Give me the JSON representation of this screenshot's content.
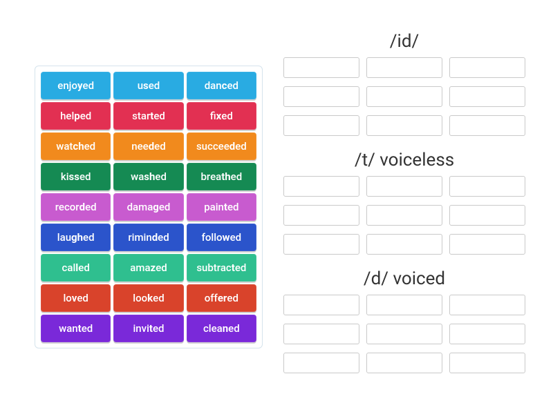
{
  "colors": {
    "blue": "#29abe2",
    "red": "#e23052",
    "orange": "#f18a1d",
    "darkgreen": "#158a53",
    "pink": "#c85bcf",
    "dblue": "#2b54cb",
    "teal": "#2fbf8f",
    "red2": "#d9432b",
    "purple": "#7a29d9"
  },
  "word_bank": {
    "rows": [
      [
        {
          "pre": "enjo",
          "bold": "y",
          "post": "ed",
          "color": "blue"
        },
        {
          "pre": "u",
          "bold": "s",
          "post": "ed",
          "color": "blue"
        },
        {
          "pre": "dan",
          "bold": "c",
          "post": "ed",
          "color": "blue"
        }
      ],
      [
        {
          "pre": "hel",
          "bold": "p",
          "post": "ed",
          "color": "red"
        },
        {
          "pre": "star",
          "bold": "t",
          "post": "ed",
          "color": "red"
        },
        {
          "pre": "fi",
          "bold": "x",
          "post": "ed",
          "color": "red"
        }
      ],
      [
        {
          "pre": "wat",
          "bold": "ch",
          "post": "ed",
          "color": "orange"
        },
        {
          "pre": "nee",
          "bold": "d",
          "post": "ed",
          "color": "orange"
        },
        {
          "pre": "succee",
          "bold": "d",
          "post": "ed",
          "color": "orange"
        }
      ],
      [
        {
          "pre": "ki",
          "bold": "ss",
          "post": "ed",
          "color": "darkgreen"
        },
        {
          "pre": "wa",
          "bold": "sh",
          "post": "ed",
          "color": "darkgreen"
        },
        {
          "pre": "brea",
          "bold": "th",
          "post": "ed",
          "color": "darkgreen"
        }
      ],
      [
        {
          "pre": "recor",
          "bold": "d",
          "post": "ed",
          "color": "pink"
        },
        {
          "pre": "dama",
          "bold": "g",
          "post": "ed",
          "color": "pink"
        },
        {
          "pre": "pain",
          "bold": "t",
          "post": "ed",
          "color": "pink"
        }
      ],
      [
        {
          "pre": "lau",
          "bold": "gh",
          "post": "ed",
          "color": "dblue"
        },
        {
          "pre": "rimin",
          "bold": "d",
          "post": "ed",
          "color": "dblue"
        },
        {
          "pre": "follo",
          "bold": "w",
          "post": "ed",
          "color": "dblue"
        }
      ],
      [
        {
          "pre": "cal",
          "bold": "l",
          "post": "ed",
          "color": "teal"
        },
        {
          "pre": "ama",
          "bold": "z",
          "post": "ed",
          "color": "teal"
        },
        {
          "pre": "subtrac",
          "bold": "t",
          "post": "ed",
          "color": "teal"
        }
      ],
      [
        {
          "pre": "lo",
          "bold": "v",
          "post": "ed",
          "color": "red2"
        },
        {
          "pre": "loo",
          "bold": "k",
          "post": "ed",
          "color": "red2"
        },
        {
          "pre": "off",
          "bold": "er",
          "post": "ed",
          "color": "red2"
        }
      ],
      [
        {
          "pre": "wan",
          "bold": "t",
          "post": "ed",
          "color": "purple"
        },
        {
          "pre": "invi",
          "bold": "t",
          "post": "ed",
          "color": "purple"
        },
        {
          "pre": "clea",
          "bold": "n",
          "post": "ed",
          "color": "purple"
        }
      ]
    ]
  },
  "target_groups": [
    {
      "title": "/id/",
      "slots": 9
    },
    {
      "title": "/t/ voiceless",
      "slots": 9
    },
    {
      "title": "/d/ voiced",
      "slots": 9
    }
  ]
}
